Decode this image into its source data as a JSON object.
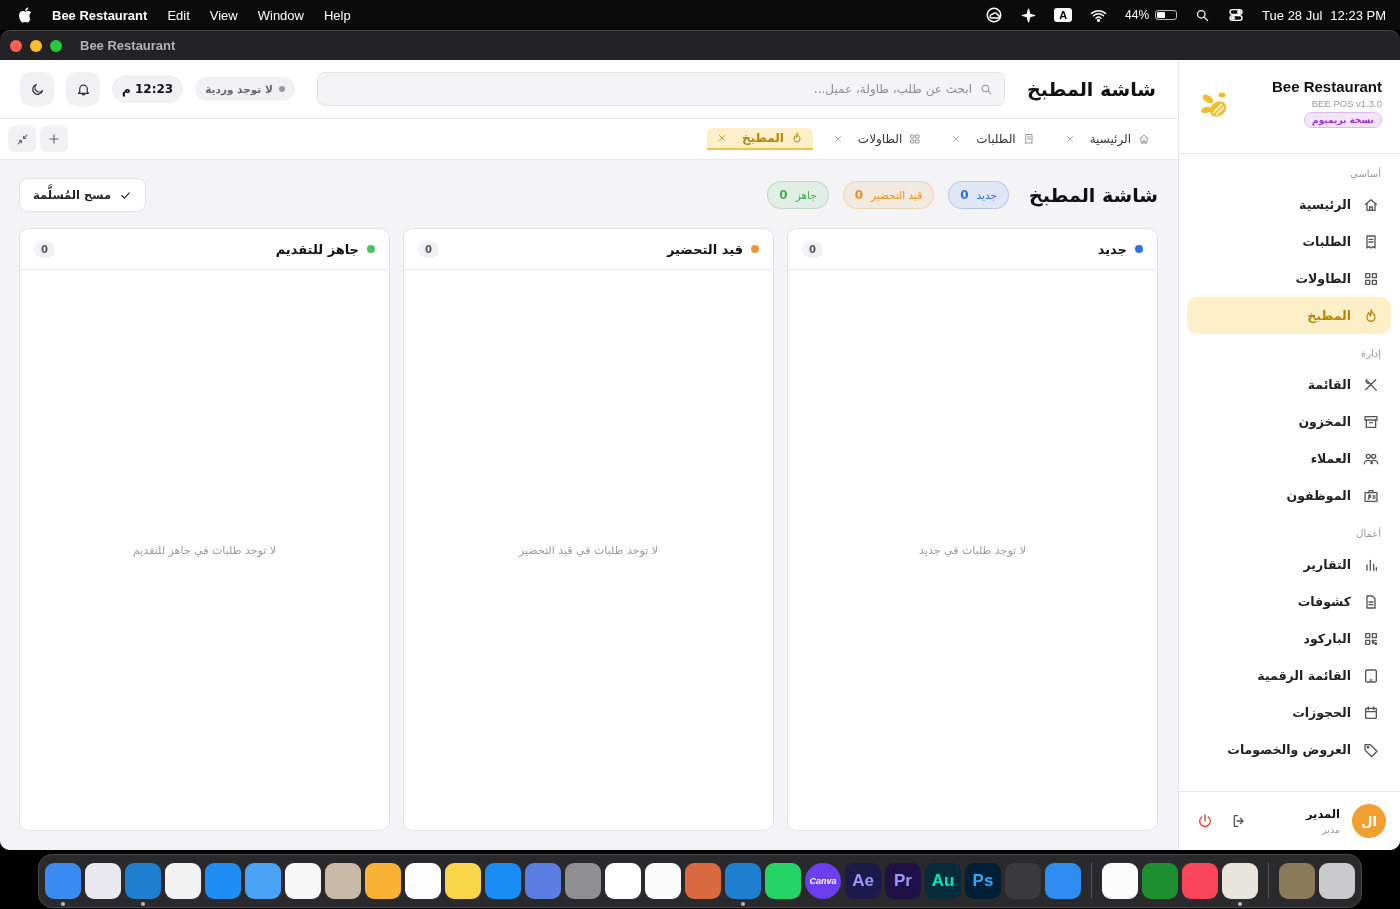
{
  "menu_bar": {
    "app_name": "Bee Restaurant",
    "menus": [
      "Help",
      "Window",
      "View",
      "Edit"
    ],
    "input_source": "A",
    "battery": "44%",
    "date": "Tue 28 Jul",
    "time": "12:23 PM"
  },
  "window": {
    "title": "Bee Restaurant"
  },
  "header": {
    "title": "شاشة المطبخ",
    "search": {
      "placeholder": "ابحث عن طلب، طاولة، عميل..."
    },
    "shift_status": "لا توجد وردية",
    "clock": "12:23 م"
  },
  "tabs": [
    {
      "kind": "home",
      "label": "الرئيسية",
      "selected": false
    },
    {
      "kind": "receipt",
      "label": "الطلبات",
      "selected": false
    },
    {
      "kind": "grid",
      "label": "الطاولات",
      "selected": false
    },
    {
      "kind": "flame",
      "label": "المطبخ",
      "selected": true
    }
  ],
  "page": {
    "title": "شاشة المطبخ",
    "summary": [
      {
        "label": "جديد",
        "count": "0",
        "color": "#2f6fe4"
      },
      {
        "label": "قيد التحضير",
        "count": "0",
        "color": "#e5901d"
      },
      {
        "label": "جاهز",
        "count": "0",
        "color": "#3fae4e"
      }
    ],
    "clear_button": "مسح المُسلَّمة"
  },
  "columns": [
    {
      "title": "جديد",
      "color": "#2f6fe4",
      "count": "0",
      "empty_text": "لا توجد طلبات في جديد"
    },
    {
      "title": "قيد التحضير",
      "color": "#f0962a",
      "count": "0",
      "empty_text": "لا توجد طلبات في قيد التحضير"
    },
    {
      "title": "جاهز للتقديم",
      "color": "#4cc159",
      "count": "0",
      "empty_text": "لا توجد طلبات في جاهز للتقديم"
    }
  ],
  "sidebar": {
    "brand": "Bee Restaurant",
    "version": "BEE POS v1.3.0",
    "plan_badge": "نسخة بريميوم",
    "sections": [
      {
        "title": "أساسي",
        "items": [
          {
            "kind": "home",
            "label": "الرئيسية",
            "selected": false
          },
          {
            "kind": "receipt",
            "label": "الطلبات",
            "selected": false
          },
          {
            "kind": "grid",
            "label": "الطاولات",
            "selected": false
          },
          {
            "kind": "flame",
            "label": "المطبخ",
            "selected": true
          }
        ]
      },
      {
        "title": "إدارة",
        "items": [
          {
            "kind": "utensils",
            "label": "القائمة",
            "selected": false
          },
          {
            "kind": "archive",
            "label": "المخزون",
            "selected": false
          },
          {
            "kind": "users",
            "label": "العملاء",
            "selected": false
          },
          {
            "kind": "idcard",
            "label": "الموظفون",
            "selected": false
          }
        ]
      },
      {
        "title": "أعمال",
        "items": [
          {
            "kind": "chart",
            "label": "التقارير",
            "selected": false
          },
          {
            "kind": "doc",
            "label": "كشوفات",
            "selected": false
          },
          {
            "kind": "qr",
            "label": "الباركود",
            "selected": false
          },
          {
            "kind": "tablet",
            "label": "القائمة الرقمية",
            "selected": false
          },
          {
            "kind": "calendar",
            "label": "الحجوزات",
            "selected": false
          },
          {
            "kind": "tag",
            "label": "العروض والخصومات",
            "selected": false
          }
        ]
      }
    ],
    "user": {
      "initials": "ال",
      "name": "المدير",
      "role": "مدير"
    }
  },
  "dock": [
    {
      "color": "#c9c9cc",
      "running": false
    },
    {
      "color": "#8a7a5a",
      "running": false,
      "separator_after": true
    },
    {
      "color": "#e8e5dc",
      "running": true
    },
    {
      "color": "#f9465a",
      "running": false
    },
    {
      "color": "#1d8f2e",
      "running": false
    },
    {
      "color": "#fcfcfc",
      "running": false,
      "separator_after": true
    },
    {
      "color": "#2f8cf0",
      "running": false
    },
    {
      "color": "#3a3a3c",
      "running": false
    },
    {
      "color": "#001e36",
      "label": "Ps",
      "running": false
    },
    {
      "color": "#062c3b",
      "label": "Au",
      "running": false
    },
    {
      "color": "#1f1145",
      "label": "Pr",
      "running": false
    },
    {
      "color": "#1b1a4a",
      "label": "Ae",
      "running": false
    },
    {
      "color": "#6b3ff0",
      "label": "Canva",
      "running": false
    },
    {
      "color": "#25d366",
      "running": false
    },
    {
      "color": "#1f7fd0",
      "running": true
    },
    {
      "color": "#d9693f",
      "running": false
    },
    {
      "color": "#fbfbfb",
      "running": false
    },
    {
      "color": "#fefefe",
      "running": false
    },
    {
      "color": "#8e8e93",
      "running": false
    },
    {
      "color": "#5b7ee5",
      "running": false
    },
    {
      "color": "#1a8cf5",
      "running": false
    },
    {
      "color": "#f7d64a",
      "running": false
    },
    {
      "color": "#fdfdfd",
      "running": false
    },
    {
      "color": "#f9b233",
      "running": false
    },
    {
      "color": "#c8b9a6",
      "running": false
    },
    {
      "color": "#f6f6f6",
      "running": false
    },
    {
      "color": "#4aa3f7",
      "running": false
    },
    {
      "color": "#1e8ef5",
      "running": false
    },
    {
      "color": "#f2f2f2",
      "running": false
    },
    {
      "color": "#1f7fd0",
      "running": true
    },
    {
      "color": "#e8e8ee",
      "running": false
    },
    {
      "color": "#3b8cf0",
      "running": true
    }
  ]
}
